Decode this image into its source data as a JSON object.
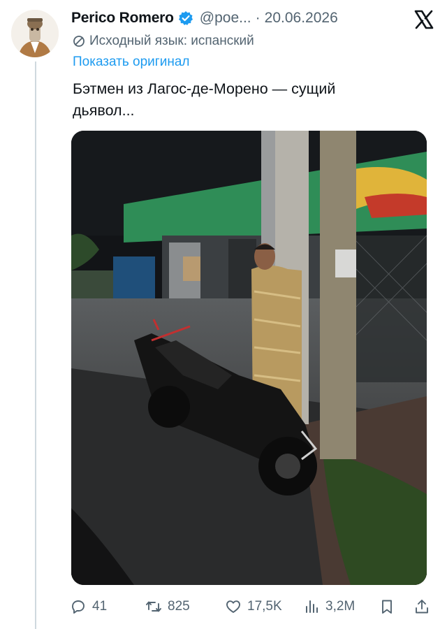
{
  "tweet": {
    "author_name": "Perico Romero",
    "handle": "@poe...",
    "separator": "·",
    "date": "20.06.2026",
    "translated_label": "Исходный язык: испанский",
    "show_original": "Показать оригинал",
    "text": "Бэтмен из Лагос-де-Морено — сущий дьявол..."
  },
  "actions": {
    "replies": "41",
    "reposts": "825",
    "likes": "17,5K",
    "views": "3,2M"
  },
  "icons": {
    "verified": "verified-badge-icon",
    "x_logo": "x-logo-icon",
    "translate": "translate-icon",
    "reply": "reply-icon",
    "retweet": "retweet-icon",
    "like": "heart-icon",
    "views": "views-icon",
    "bookmark": "bookmark-icon",
    "share": "share-icon"
  },
  "colors": {
    "text": "#0f1419",
    "secondary": "#536471",
    "link": "#1d9bf0",
    "thread_line": "#cfd9de"
  }
}
